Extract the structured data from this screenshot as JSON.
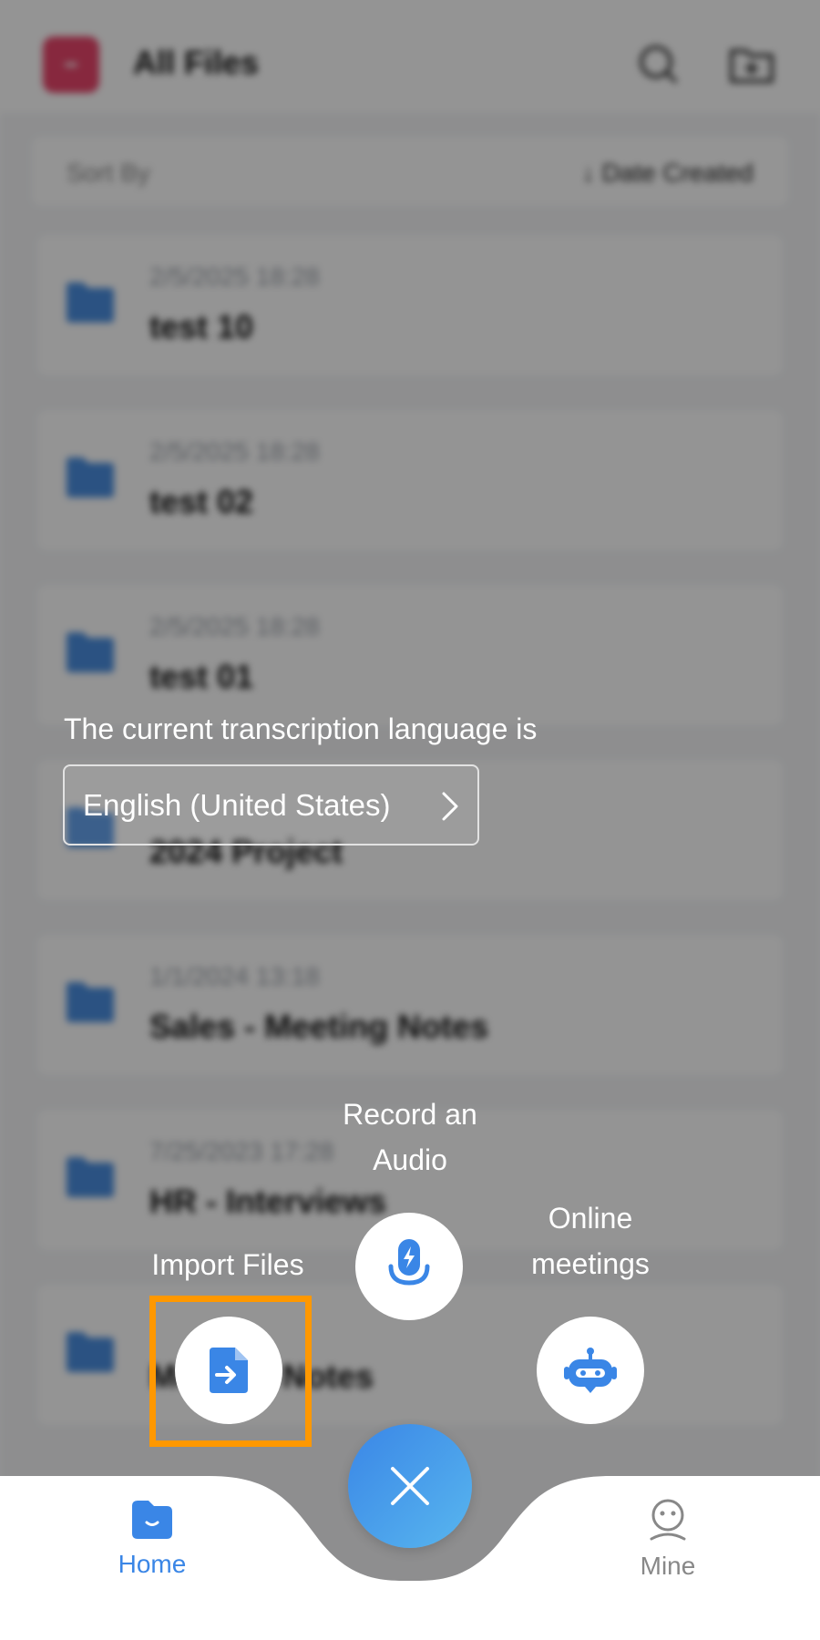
{
  "header": {
    "title": "All Files",
    "logo_color": "#e8466b"
  },
  "sortbar": {
    "label": "Sort By",
    "value": "↓ Date Created"
  },
  "files": [
    {
      "date": "2/5/2025  18:28",
      "name": "test 10"
    },
    {
      "date": "2/5/2025  18:28",
      "name": "test 02"
    },
    {
      "date": "2/5/2025  18:28",
      "name": "test 01"
    },
    {
      "date": "",
      "name": "2024 Project"
    },
    {
      "date": "1/1/2024  13:18",
      "name": "Sales - Meeting Notes"
    },
    {
      "date": "7/25/2023  17:28",
      "name": "HR - Interviews"
    },
    {
      "date": "",
      "name": "Meeting Notes"
    }
  ],
  "language_notice": {
    "text": "The current transcription language is",
    "language": "English (United States)"
  },
  "actions": {
    "record": {
      "label_line1": "Record an",
      "label_line2": "Audio",
      "icon": "microphone-icon"
    },
    "import": {
      "label": "Import Files",
      "icon": "import-file-icon"
    },
    "meetings": {
      "label_line1": "Online",
      "label_line2": "meetings",
      "icon": "robot-icon"
    }
  },
  "nav": {
    "home_label": "Home",
    "mine_label": "Mine",
    "active_color": "#3a86e6",
    "inactive_color": "#888888"
  },
  "colors": {
    "accent": "#3a86e6",
    "highlight": "#ff9800",
    "folder": "#4a8ee0"
  }
}
